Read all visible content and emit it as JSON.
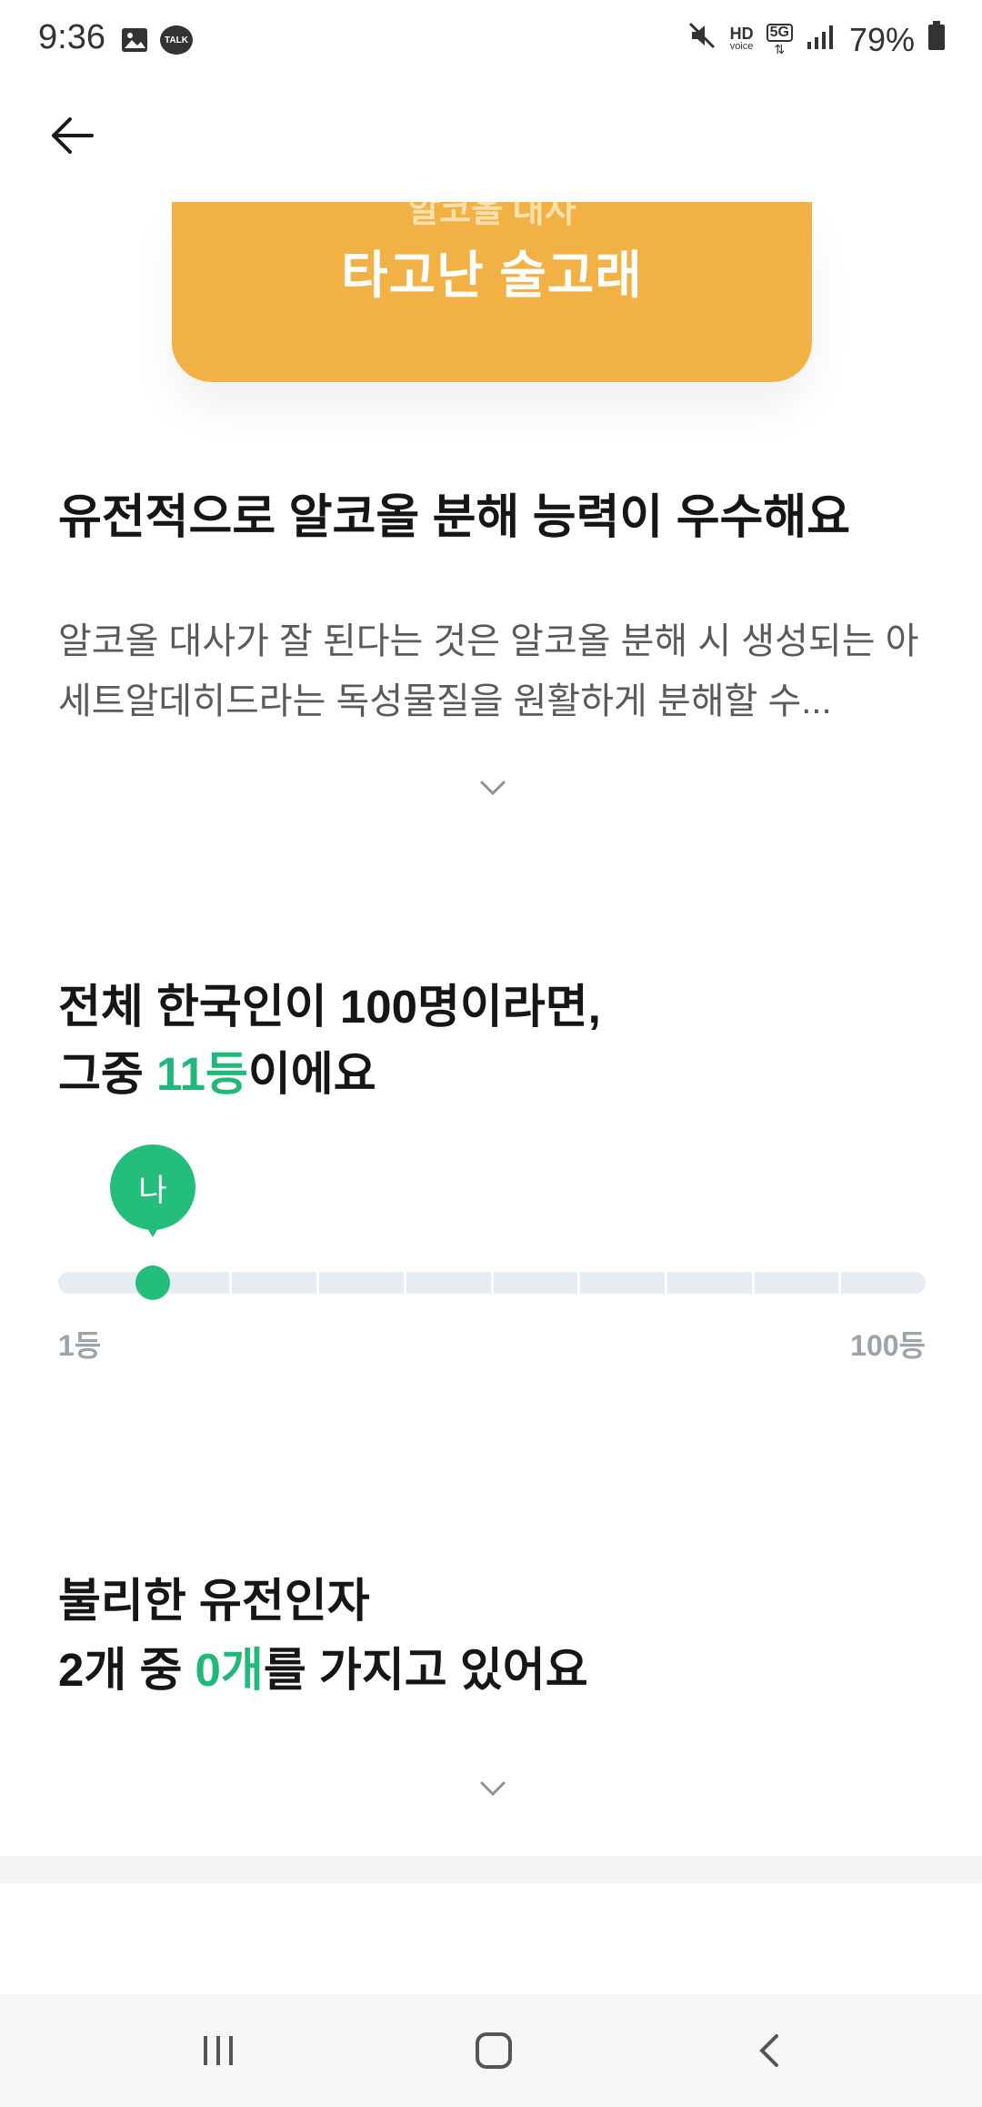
{
  "status_bar": {
    "time": "9:36",
    "battery": "79%",
    "left_icons": [
      "gallery-icon",
      "kakaotalk-icon"
    ],
    "right_icons": [
      "mute-icon",
      "hd-voice-icon",
      "5g-icon",
      "signal-icon",
      "battery-icon"
    ],
    "talk_label": "TALK",
    "hd_label": "HD",
    "voice_label": "voice",
    "network_label": "5G"
  },
  "app_bar": {
    "back_icon": "arrow-left-icon"
  },
  "card": {
    "subtitle": "알코올 대사",
    "title": "타고난 술고래",
    "color": "#f2b144"
  },
  "trait": {
    "headline": "유전적으로 알코올 분해 능력이 우수해요",
    "description": "알코올 대사가 잘 된다는 것은 알코올 분해 시 생성되는 아세트알데히드라는 독성물질을 원활하게 분해할 수...",
    "expand_icon": "chevron-down-icon"
  },
  "ranking": {
    "line1": "전체 한국인이 100명이라면,",
    "line2_prefix": "그중 ",
    "rank_value": "11등",
    "line2_suffix": "이에요",
    "marker_label": "나",
    "rank_fraction": 0.11,
    "scale_min": "1등",
    "scale_max": "100등",
    "accent_color": "#20b97a"
  },
  "genes": {
    "line1": "불리한 유전인자",
    "line2_prefix": "2개 중 ",
    "count_value": "0개",
    "line2_suffix": "를 가지고 있어요",
    "expand_icon": "chevron-down-icon"
  },
  "nav_bar": {
    "buttons": [
      "recents-icon",
      "home-icon",
      "back-icon"
    ]
  }
}
